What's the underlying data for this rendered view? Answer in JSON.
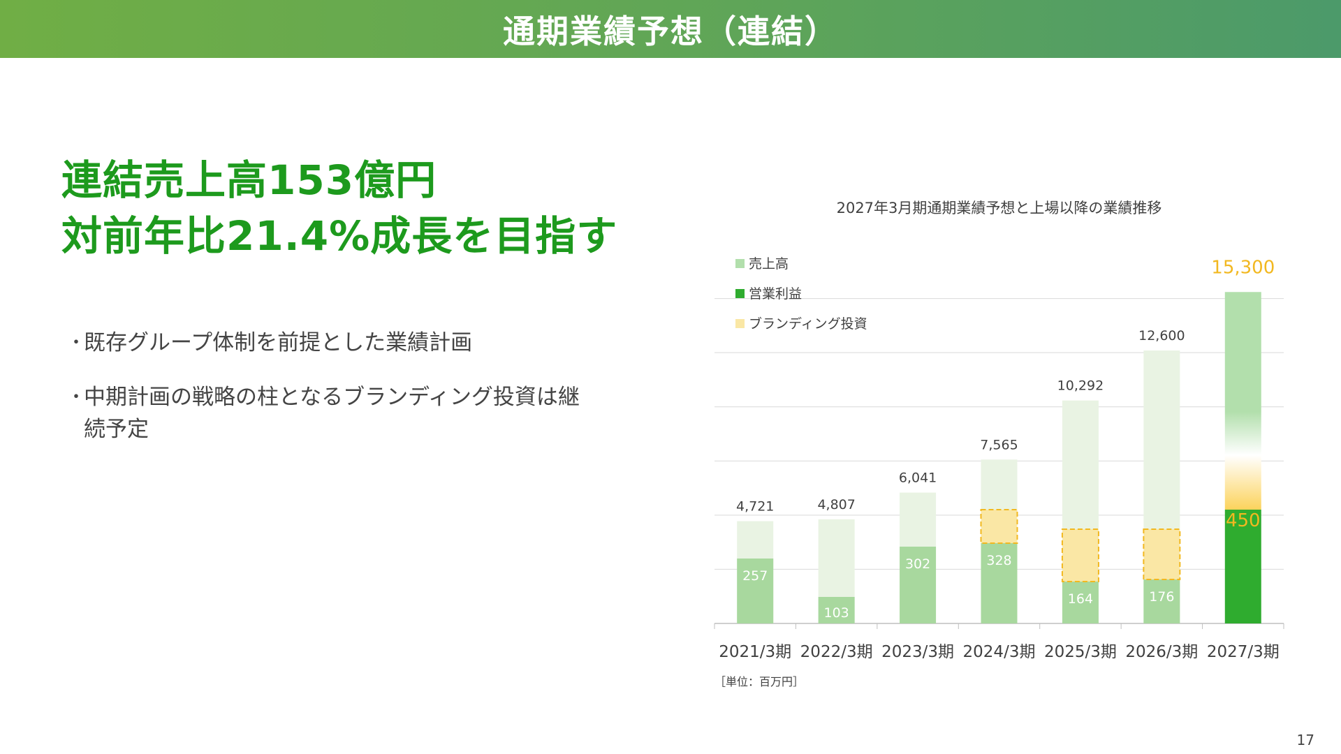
{
  "header": {
    "title": "通期業績予想（連結）"
  },
  "headline": {
    "line1": "連結売上高153億円",
    "line2": "対前年比21.4%成長を目指す"
  },
  "bullets": [
    {
      "text": "既存グループ体制を前提とした業績計画"
    },
    {
      "text": "中期計画の戦略の柱となるブランディング投資は継続予定"
    }
  ],
  "page_number": "17",
  "chart_data": {
    "type": "bar",
    "title": "2027年3月期通期業績予想と上場以降の業績推移",
    "unit_note": "［単位：百万円］",
    "categories": [
      "2021/3期",
      "2022/3期",
      "2023/3期",
      "2024/3期",
      "2025/3期",
      "2026/3期",
      "2027/3期"
    ],
    "series": [
      {
        "name": "売上高",
        "values": [
          4721,
          4807,
          6041,
          7565,
          10292,
          12600,
          15300
        ],
        "labels": [
          "4,721",
          "4,807",
          "6,041",
          "7,565",
          "10,292",
          "12,600",
          "15,300"
        ]
      },
      {
        "name": "営業利益",
        "values": [
          257,
          103,
          302,
          328,
          164,
          176,
          450
        ],
        "labels": [
          "257",
          "103",
          "302",
          "328",
          "164",
          "176",
          "450"
        ]
      },
      {
        "name": "ブランディング投資"
      }
    ],
    "ylim": [
      0,
      17500
    ],
    "grid": true,
    "legend_position": "top-left",
    "colors": {
      "revenue_faded": "#e9f3e3",
      "revenue": "#b2dfac",
      "profit_light": "#a8d89e",
      "profit_dark": "#2fac2f",
      "branding_fill": "#fae7a5",
      "branding_border": "#f2b820",
      "highlight_text": "#f2b820",
      "grid": "#d9d9d9",
      "text": "#404040"
    }
  }
}
